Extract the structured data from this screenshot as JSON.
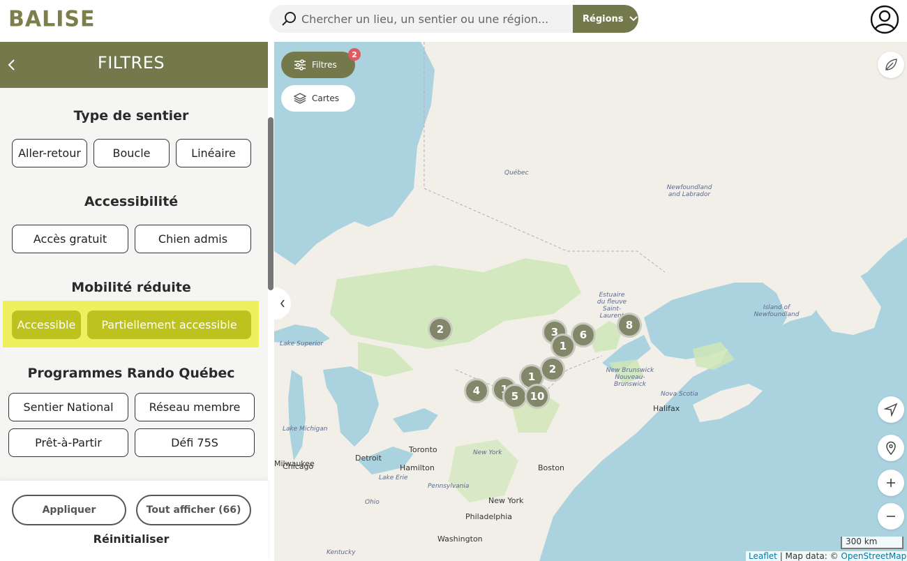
{
  "header": {
    "logo": "BALISE",
    "search_placeholder": "Chercher un lieu, un sentier ou une région...",
    "regions_label": "Régions"
  },
  "panel": {
    "title": "FILTRES",
    "sections": {
      "type": {
        "title": "Type de sentier",
        "options": [
          "Aller-retour",
          "Boucle",
          "Linéaire"
        ]
      },
      "access": {
        "title": "Accessibilité",
        "options": [
          "Accès gratuit",
          "Chien admis"
        ]
      },
      "mobility": {
        "title": "Mobilité réduite",
        "options": [
          "Accessible",
          "Partiellement accessible"
        ]
      },
      "programs": {
        "title": "Programmes Rando Québec",
        "options": [
          "Sentier National",
          "Réseau membre",
          "Prêt-à-Partir",
          "Défi 75S"
        ]
      }
    },
    "footer": {
      "apply": "Appliquer",
      "show_all": "Tout afficher (66)",
      "reset": "Réinitialiser"
    }
  },
  "map": {
    "filtres_label": "Filtres",
    "filtres_badge": "2",
    "cartes_label": "Cartes",
    "labels": {
      "quebec": "Québec",
      "nfl": "Newfoundland\nand Labrador",
      "island_nfl": "Island of\nNewfoundland",
      "estuaire": "Estuaire\ndu fleuve\nSaint-\nLaurent",
      "nb": "New Brunswick\nNouveau-\nBrunswick",
      "ns": "Nova Scotia",
      "halifax": "Halifax",
      "toronto": "Toronto",
      "hamilton": "Hamilton",
      "milwaukee": "Milwaukee",
      "chicago": "Chicago",
      "detroit": "Detroit",
      "newyork_state": "New York",
      "boston": "Boston",
      "newyork": "New York",
      "philadelphia": "Philadelphia",
      "pennsylvania": "Pennsylvania",
      "ohio": "Ohio",
      "washington": "Washington",
      "kentucky": "Kentucky",
      "lake_superior": "Lake Superior",
      "lake_michigan": "Lake Michigan",
      "lake_erie": "Lake Erie"
    },
    "clusters": [
      "2",
      "3",
      "6",
      "1",
      "8",
      "1",
      "2",
      "1",
      "4",
      "5",
      "10"
    ],
    "scale": "300 km",
    "attribution_leaflet": "Leaflet",
    "attribution_text": "| Map data: ©",
    "attribution_osm": "OpenStreetMap"
  }
}
